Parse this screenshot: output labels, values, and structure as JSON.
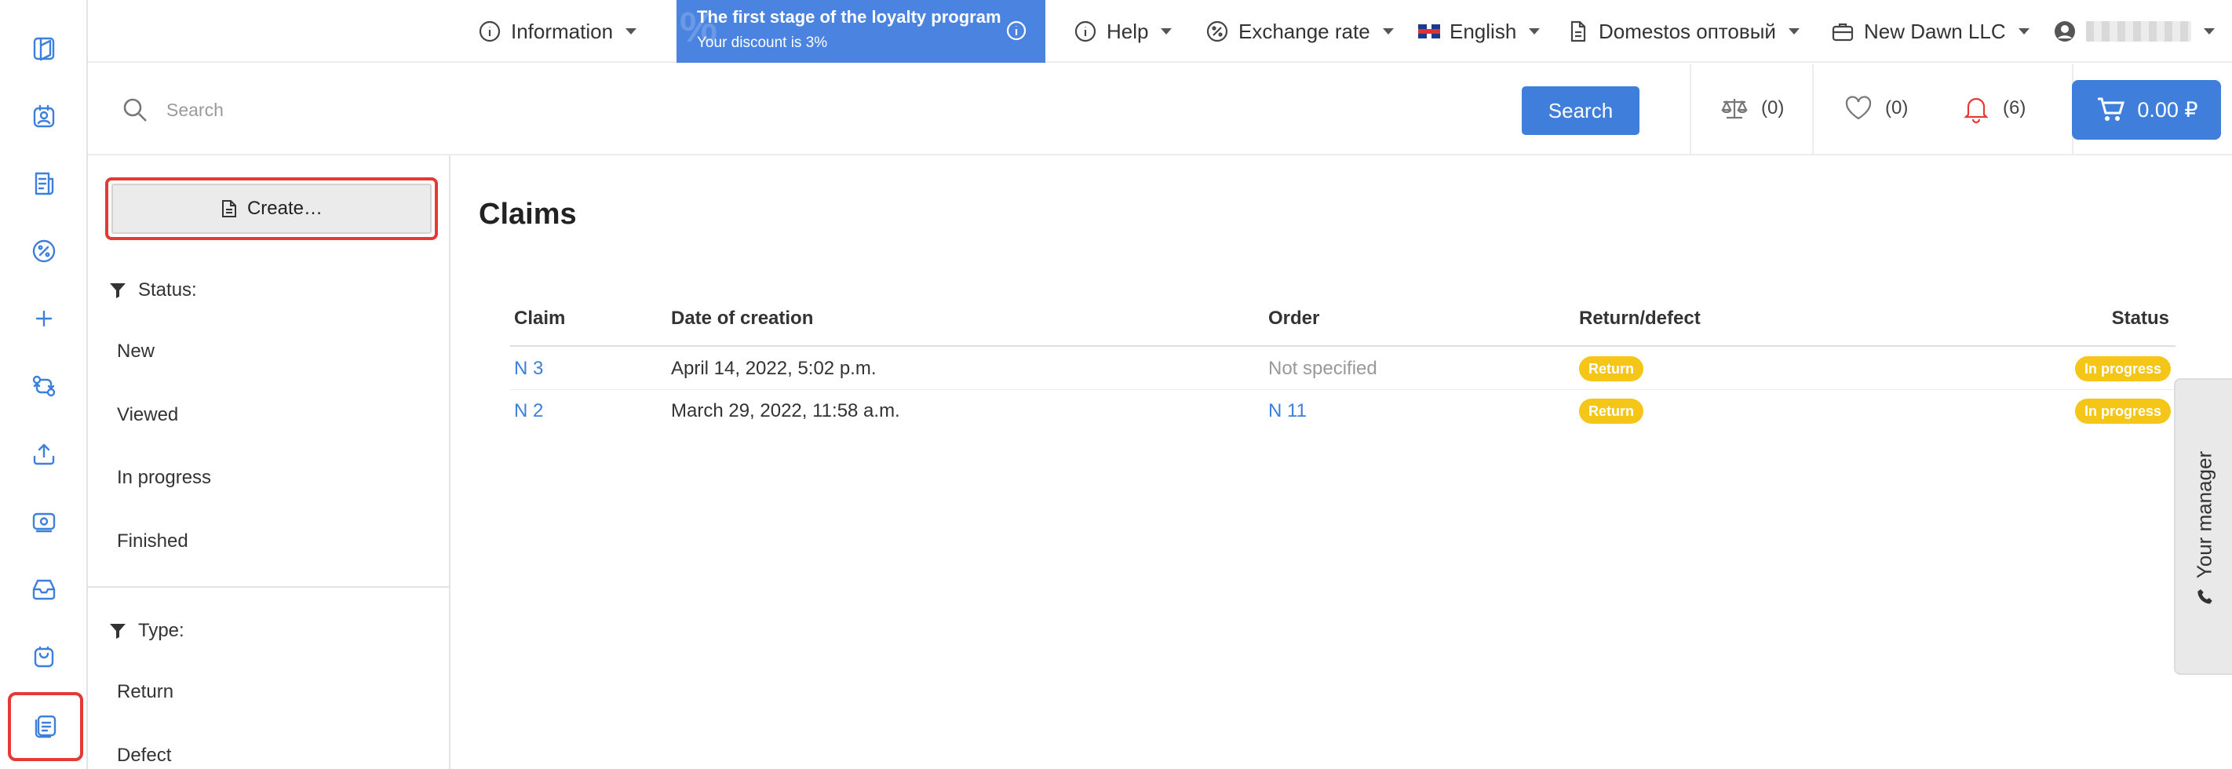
{
  "topbar": {
    "information": "Information",
    "loyalty_title": "The first stage of the loyalty program",
    "loyalty_subtitle": "Your discount is 3%",
    "help": "Help",
    "exchange_rate": "Exchange rate",
    "language": "English",
    "store": "Domestos оптовый",
    "company": "New Dawn LLC"
  },
  "search": {
    "placeholder": "Search",
    "button": "Search"
  },
  "counters": {
    "compare": "(0)",
    "favorites": "(0)",
    "notifications": "(6)",
    "cart_total": "0.00 ₽"
  },
  "sidebar": {
    "create_label": "Create…",
    "status_heading": "Status:",
    "status_options": [
      "New",
      "Viewed",
      "In progress",
      "Finished"
    ],
    "type_heading": "Type:",
    "type_options": [
      "Return",
      "Defect"
    ]
  },
  "rail": {
    "icons": [
      "catalog-icon",
      "contact-icon",
      "orders-icon",
      "discount-icon",
      "add-icon",
      "exchange-icon",
      "upload-icon",
      "money-icon",
      "inbox-icon",
      "bag-icon",
      "claims-icon"
    ],
    "active": "claims-icon"
  },
  "main": {
    "title": "Claims",
    "columns": [
      "Claim",
      "Date of creation",
      "Order",
      "Return/defect",
      "Status"
    ],
    "rows": [
      {
        "claim": "N 3",
        "date": "April 14, 2022, 5:02 p.m.",
        "order": "Not specified",
        "type": "Return",
        "status": "In progress"
      },
      {
        "claim": "N 2",
        "date": "March 29, 2022, 11:58 a.m.",
        "order": "N 11",
        "type": "Return",
        "status": "In progress"
      }
    ]
  },
  "manager_tab": {
    "label": "Your manager"
  },
  "colors": {
    "accent": "#3f7fdb",
    "loyalty": "#4a84e0",
    "badge": "#f5c518",
    "highlight": "#e53935",
    "bell": "#e53935"
  }
}
